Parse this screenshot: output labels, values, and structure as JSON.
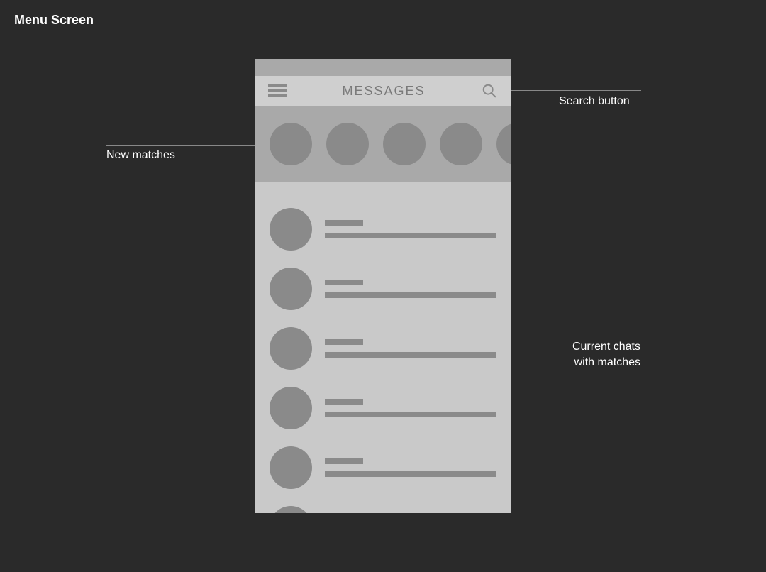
{
  "page": {
    "title": "Menu Screen"
  },
  "header": {
    "title": "MESSAGES"
  },
  "annotations": {
    "search": "Search button",
    "new_matches": "New matches",
    "chats_line1": "Current chats",
    "chats_line2": "with matches"
  },
  "colors": {
    "bg": "#2a2a2a",
    "phone_bg": "#c9c9c9",
    "strip_bg": "#a9a9a9",
    "placeholder": "#8a8a8a",
    "header_text": "#7a7a7a",
    "label_text": "#ffffff"
  },
  "matches": [
    {
      "id": "m1"
    },
    {
      "id": "m2"
    },
    {
      "id": "m3"
    },
    {
      "id": "m4"
    },
    {
      "id": "m5"
    }
  ],
  "chats": [
    {
      "id": "c1"
    },
    {
      "id": "c2"
    },
    {
      "id": "c3"
    },
    {
      "id": "c4"
    },
    {
      "id": "c5"
    },
    {
      "id": "c6"
    }
  ]
}
